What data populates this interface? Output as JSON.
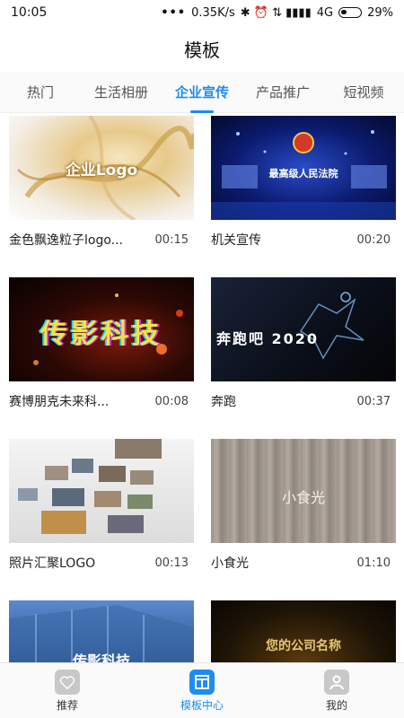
{
  "status": {
    "time": "10:05",
    "dots": "•••",
    "speed": "0.35K/s",
    "icons": "✱ ⏰ ⇅ ▮▮▮▮",
    "network": "4G",
    "battery": "29%"
  },
  "header": {
    "title": "模板"
  },
  "tabs": [
    {
      "label": "热门"
    },
    {
      "label": "生活相册"
    },
    {
      "label": "企业宣传"
    },
    {
      "label": "产品推广"
    },
    {
      "label": "短视频"
    }
  ],
  "templates": [
    {
      "name": "金色飘逸粒子logo...",
      "duration": "00:15",
      "overlay": "企业Logo"
    },
    {
      "name": "机关宣传",
      "duration": "00:20",
      "overlay": "最高级人民法院"
    },
    {
      "name": "赛博朋克未来科...",
      "duration": "00:08",
      "overlay": "传影科技"
    },
    {
      "name": "奔跑",
      "duration": "00:37",
      "overlay": "奔跑吧 2020"
    },
    {
      "name": "照片汇聚LOGO",
      "duration": "00:13",
      "overlay": ""
    },
    {
      "name": "小食光",
      "duration": "01:10",
      "overlay": "小食光"
    },
    {
      "name": "",
      "duration": "",
      "overlay": "传影科技"
    },
    {
      "name": "",
      "duration": "",
      "overlay": "您的公司名称"
    }
  ],
  "nav": [
    {
      "label": "推荐",
      "icon": "heart-icon"
    },
    {
      "label": "模板中心",
      "icon": "template-icon"
    },
    {
      "label": "我的",
      "icon": "user-icon"
    }
  ],
  "colors": {
    "accent": "#1e8cf0"
  }
}
